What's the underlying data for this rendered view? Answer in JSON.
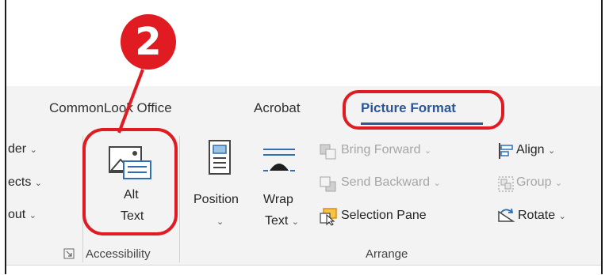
{
  "annotation": {
    "step_number": "2"
  },
  "tabs": {
    "commonlook": "CommonLook Office",
    "acrobat": "Acrobat",
    "picture_format": "Picture Format"
  },
  "left_cutoff": {
    "item1": "der",
    "item2": "ects",
    "item3": "out"
  },
  "accessibility": {
    "alt_text_line1": "Alt",
    "alt_text_line2": "Text",
    "group_label": "Accessibility"
  },
  "arrange": {
    "position": "Position",
    "wrap_line1": "Wrap",
    "wrap_line2": "Text",
    "bring_forward": "Bring Forward",
    "send_backward": "Send Backward",
    "selection_pane": "Selection Pane",
    "align": "Align",
    "group": "Group",
    "rotate": "Rotate",
    "group_label": "Arrange"
  },
  "icons": {
    "chevron": "chevron-down-icon",
    "dialog_launcher": "dialog-launcher-icon"
  },
  "colors": {
    "annotation_red": "#e01b22",
    "active_tab_blue": "#2b579a",
    "ribbon_bg": "#f3f3f3",
    "disabled_text": "#a6a6a6"
  }
}
